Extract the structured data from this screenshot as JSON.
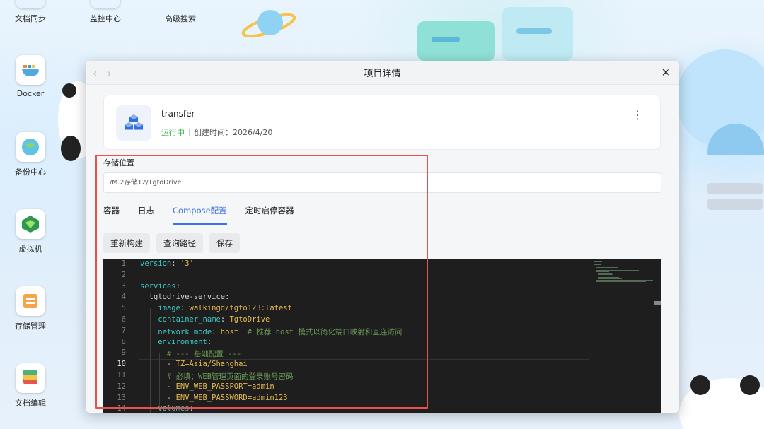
{
  "desktop": {
    "icons": [
      {
        "label": "文档同步"
      },
      {
        "label": "监控中心"
      },
      {
        "label": "高级搜索"
      },
      {
        "label": "Docker"
      },
      {
        "label": "备份中心"
      },
      {
        "label": "虚拟机"
      },
      {
        "label": "存储管理"
      },
      {
        "label": "文档编辑"
      }
    ]
  },
  "window": {
    "title": "项目详情",
    "back_icon": "chevron-left-icon",
    "forward_icon": "chevron-right-icon",
    "close_icon": "close-icon"
  },
  "app": {
    "name": "transfer",
    "status": "运行中",
    "created": "创建时间：2026/4/20",
    "status_color": "#3bb54a"
  },
  "storage": {
    "label": "存储位置",
    "path": "/M.2存储12/TgtoDrive"
  },
  "tabs": [
    {
      "label": "容器",
      "active": false
    },
    {
      "label": "日志",
      "active": false
    },
    {
      "label": "Compose配置",
      "active": true
    },
    {
      "label": "定时启停容器",
      "active": false
    }
  ],
  "actions": {
    "rebuild": "重新构建",
    "query_path": "查询路径",
    "save": "保存"
  },
  "editor": {
    "current_line": 10,
    "lines": [
      {
        "n": "1",
        "text": "version: '3'"
      },
      {
        "n": "2",
        "text": ""
      },
      {
        "n": "3",
        "text": "services:"
      },
      {
        "n": "4",
        "text": "  tgtodrive-service:"
      },
      {
        "n": "5",
        "text": "    image: walkingd/tgto123:latest"
      },
      {
        "n": "6",
        "text": "    container_name: TgtoDrive"
      },
      {
        "n": "7",
        "text": "    network_mode: host  # 推荐 host 模式以简化端口映射和直连访问"
      },
      {
        "n": "8",
        "text": "    environment:"
      },
      {
        "n": "9",
        "text": "      # --- 基础配置 ---"
      },
      {
        "n": "10",
        "text": "      - TZ=Asia/Shanghai"
      },
      {
        "n": "11",
        "text": "      # 必填：WEB管理页面的登录账号密码"
      },
      {
        "n": "12",
        "text": "      - ENV_WEB_PASSPORT=admin"
      },
      {
        "n": "13",
        "text": "      - ENV_WEB_PASSWORD=admin123"
      },
      {
        "n": "14",
        "text": "    volumes:"
      }
    ]
  },
  "colors": {
    "accent": "#3b73e6",
    "highlight_box": "#e8514e",
    "editor_bg": "#1e1e1e"
  }
}
